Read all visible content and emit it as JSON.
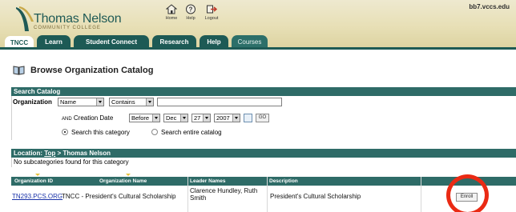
{
  "header": {
    "logo_title": "Thomas Nelson",
    "logo_subtitle": "COMMUNITY COLLEGE",
    "host": "bb7.vccs.edu",
    "top_links": [
      {
        "label": "Home",
        "icon": "home-icon"
      },
      {
        "label": "Help",
        "icon": "help-icon"
      },
      {
        "label": "Logout",
        "icon": "logout-icon"
      }
    ]
  },
  "tabs": [
    {
      "label": "TNCC",
      "active": true
    },
    {
      "label": "Learn"
    },
    {
      "label": "Student Connect"
    },
    {
      "label": "Research"
    },
    {
      "label": "Help"
    },
    {
      "label": "Courses"
    }
  ],
  "page": {
    "title": "Browse Organization Catalog",
    "title_icon": "book-icon"
  },
  "search": {
    "section_title": "Search Catalog",
    "field_label": "Organization",
    "field_select": "Name",
    "operator_select": "Contains",
    "query_value": "",
    "and_label": "AND",
    "date_label": "Creation Date",
    "date_operator": "Before",
    "month": "Dec",
    "day": "27",
    "year": "2007",
    "go_label": "GO",
    "scope_options": [
      "Search this category",
      "Search entire catalog"
    ],
    "scope_selected": "Search this category"
  },
  "location": {
    "label": "Location:",
    "top_link": "Top",
    "separator": ">",
    "current": "Thomas Nelson",
    "message": "No subcategories found for this category"
  },
  "table": {
    "headers": [
      "Organization ID",
      "Organization Name",
      "Leader Names",
      "Description"
    ],
    "rows": [
      {
        "id": "TN293.PCS.ORG",
        "name": "TNCC - President's Cultural Scholarship",
        "leaders_line1": "Clarence Hundley, Ruth",
        "leaders_line2": "Smith",
        "description": "President's Cultural Scholarship",
        "action": "Enroll"
      }
    ]
  },
  "colors": {
    "brand_teal": "#1d5a55",
    "bar_teal": "#2e6b67",
    "header_bg": "#e7dfb5",
    "link_blue": "#1a33a8",
    "highlight_red": "#ea2a14"
  }
}
